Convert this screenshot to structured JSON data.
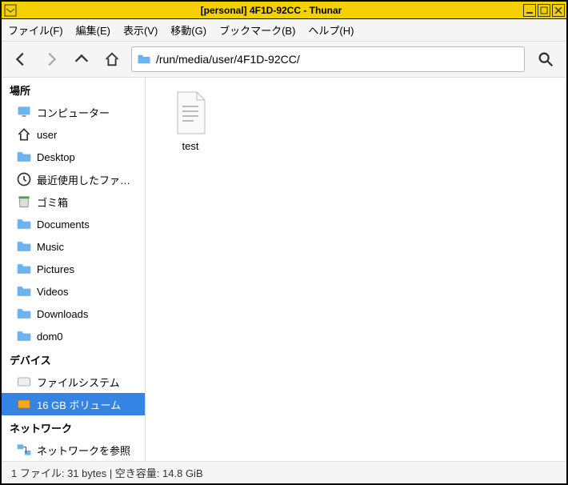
{
  "titlebar": {
    "title": "[personal] 4F1D-92CC - Thunar"
  },
  "menus": {
    "file": "ファイル(F)",
    "edit": "編集(E)",
    "view": "表示(V)",
    "go": "移動(G)",
    "bookmarks": "ブックマーク(B)",
    "help": "ヘルプ(H)"
  },
  "path": {
    "value": "/run/media/user/4F1D-92CC/"
  },
  "sidebar": {
    "places_header": "場所",
    "devices_header": "デバイス",
    "network_header": "ネットワーク",
    "places": [
      {
        "label": "コンピューター",
        "icon": "monitor"
      },
      {
        "label": "user",
        "icon": "home"
      },
      {
        "label": "Desktop",
        "icon": "folder"
      },
      {
        "label": "最近使用したファ…",
        "icon": "clock"
      },
      {
        "label": "ゴミ箱",
        "icon": "trash"
      },
      {
        "label": "Documents",
        "icon": "folder"
      },
      {
        "label": "Music",
        "icon": "folder"
      },
      {
        "label": "Pictures",
        "icon": "folder"
      },
      {
        "label": "Videos",
        "icon": "folder"
      },
      {
        "label": "Downloads",
        "icon": "folder"
      },
      {
        "label": "dom0",
        "icon": "folder"
      }
    ],
    "devices": [
      {
        "label": "ファイルシステム",
        "icon": "disk",
        "selected": false
      },
      {
        "label": "16 GB ボリューム",
        "icon": "disk-orange",
        "selected": true
      }
    ],
    "network": [
      {
        "label": "ネットワークを参照",
        "icon": "network"
      }
    ]
  },
  "files": [
    {
      "name": "test",
      "type": "text"
    }
  ],
  "status": "1 ファイル: 31 bytes  |  空き容量: 14.8 GiB"
}
